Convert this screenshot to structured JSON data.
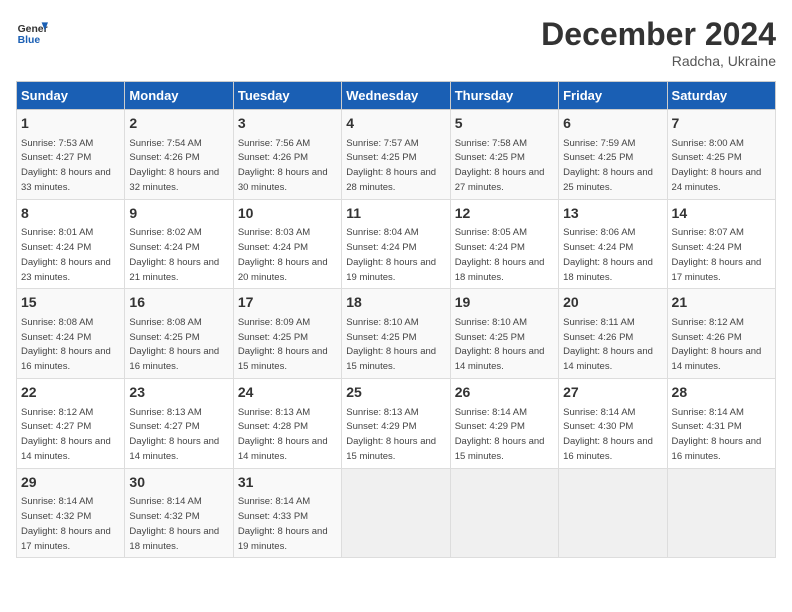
{
  "header": {
    "logo_line1": "General",
    "logo_line2": "Blue",
    "month": "December 2024",
    "location": "Radcha, Ukraine"
  },
  "days_of_week": [
    "Sunday",
    "Monday",
    "Tuesday",
    "Wednesday",
    "Thursday",
    "Friday",
    "Saturday"
  ],
  "weeks": [
    [
      {
        "num": "1",
        "sunrise": "7:53 AM",
        "sunset": "4:27 PM",
        "daylight": "8 hours and 33 minutes."
      },
      {
        "num": "2",
        "sunrise": "7:54 AM",
        "sunset": "4:26 PM",
        "daylight": "8 hours and 32 minutes."
      },
      {
        "num": "3",
        "sunrise": "7:56 AM",
        "sunset": "4:26 PM",
        "daylight": "8 hours and 30 minutes."
      },
      {
        "num": "4",
        "sunrise": "7:57 AM",
        "sunset": "4:25 PM",
        "daylight": "8 hours and 28 minutes."
      },
      {
        "num": "5",
        "sunrise": "7:58 AM",
        "sunset": "4:25 PM",
        "daylight": "8 hours and 27 minutes."
      },
      {
        "num": "6",
        "sunrise": "7:59 AM",
        "sunset": "4:25 PM",
        "daylight": "8 hours and 25 minutes."
      },
      {
        "num": "7",
        "sunrise": "8:00 AM",
        "sunset": "4:25 PM",
        "daylight": "8 hours and 24 minutes."
      }
    ],
    [
      {
        "num": "8",
        "sunrise": "8:01 AM",
        "sunset": "4:24 PM",
        "daylight": "8 hours and 23 minutes."
      },
      {
        "num": "9",
        "sunrise": "8:02 AM",
        "sunset": "4:24 PM",
        "daylight": "8 hours and 21 minutes."
      },
      {
        "num": "10",
        "sunrise": "8:03 AM",
        "sunset": "4:24 PM",
        "daylight": "8 hours and 20 minutes."
      },
      {
        "num": "11",
        "sunrise": "8:04 AM",
        "sunset": "4:24 PM",
        "daylight": "8 hours and 19 minutes."
      },
      {
        "num": "12",
        "sunrise": "8:05 AM",
        "sunset": "4:24 PM",
        "daylight": "8 hours and 18 minutes."
      },
      {
        "num": "13",
        "sunrise": "8:06 AM",
        "sunset": "4:24 PM",
        "daylight": "8 hours and 18 minutes."
      },
      {
        "num": "14",
        "sunrise": "8:07 AM",
        "sunset": "4:24 PM",
        "daylight": "8 hours and 17 minutes."
      }
    ],
    [
      {
        "num": "15",
        "sunrise": "8:08 AM",
        "sunset": "4:24 PM",
        "daylight": "8 hours and 16 minutes."
      },
      {
        "num": "16",
        "sunrise": "8:08 AM",
        "sunset": "4:25 PM",
        "daylight": "8 hours and 16 minutes."
      },
      {
        "num": "17",
        "sunrise": "8:09 AM",
        "sunset": "4:25 PM",
        "daylight": "8 hours and 15 minutes."
      },
      {
        "num": "18",
        "sunrise": "8:10 AM",
        "sunset": "4:25 PM",
        "daylight": "8 hours and 15 minutes."
      },
      {
        "num": "19",
        "sunrise": "8:10 AM",
        "sunset": "4:25 PM",
        "daylight": "8 hours and 14 minutes."
      },
      {
        "num": "20",
        "sunrise": "8:11 AM",
        "sunset": "4:26 PM",
        "daylight": "8 hours and 14 minutes."
      },
      {
        "num": "21",
        "sunrise": "8:12 AM",
        "sunset": "4:26 PM",
        "daylight": "8 hours and 14 minutes."
      }
    ],
    [
      {
        "num": "22",
        "sunrise": "8:12 AM",
        "sunset": "4:27 PM",
        "daylight": "8 hours and 14 minutes."
      },
      {
        "num": "23",
        "sunrise": "8:13 AM",
        "sunset": "4:27 PM",
        "daylight": "8 hours and 14 minutes."
      },
      {
        "num": "24",
        "sunrise": "8:13 AM",
        "sunset": "4:28 PM",
        "daylight": "8 hours and 14 minutes."
      },
      {
        "num": "25",
        "sunrise": "8:13 AM",
        "sunset": "4:29 PM",
        "daylight": "8 hours and 15 minutes."
      },
      {
        "num": "26",
        "sunrise": "8:14 AM",
        "sunset": "4:29 PM",
        "daylight": "8 hours and 15 minutes."
      },
      {
        "num": "27",
        "sunrise": "8:14 AM",
        "sunset": "4:30 PM",
        "daylight": "8 hours and 16 minutes."
      },
      {
        "num": "28",
        "sunrise": "8:14 AM",
        "sunset": "4:31 PM",
        "daylight": "8 hours and 16 minutes."
      }
    ],
    [
      {
        "num": "29",
        "sunrise": "8:14 AM",
        "sunset": "4:32 PM",
        "daylight": "8 hours and 17 minutes."
      },
      {
        "num": "30",
        "sunrise": "8:14 AM",
        "sunset": "4:32 PM",
        "daylight": "8 hours and 18 minutes."
      },
      {
        "num": "31",
        "sunrise": "8:14 AM",
        "sunset": "4:33 PM",
        "daylight": "8 hours and 19 minutes."
      },
      null,
      null,
      null,
      null
    ]
  ]
}
